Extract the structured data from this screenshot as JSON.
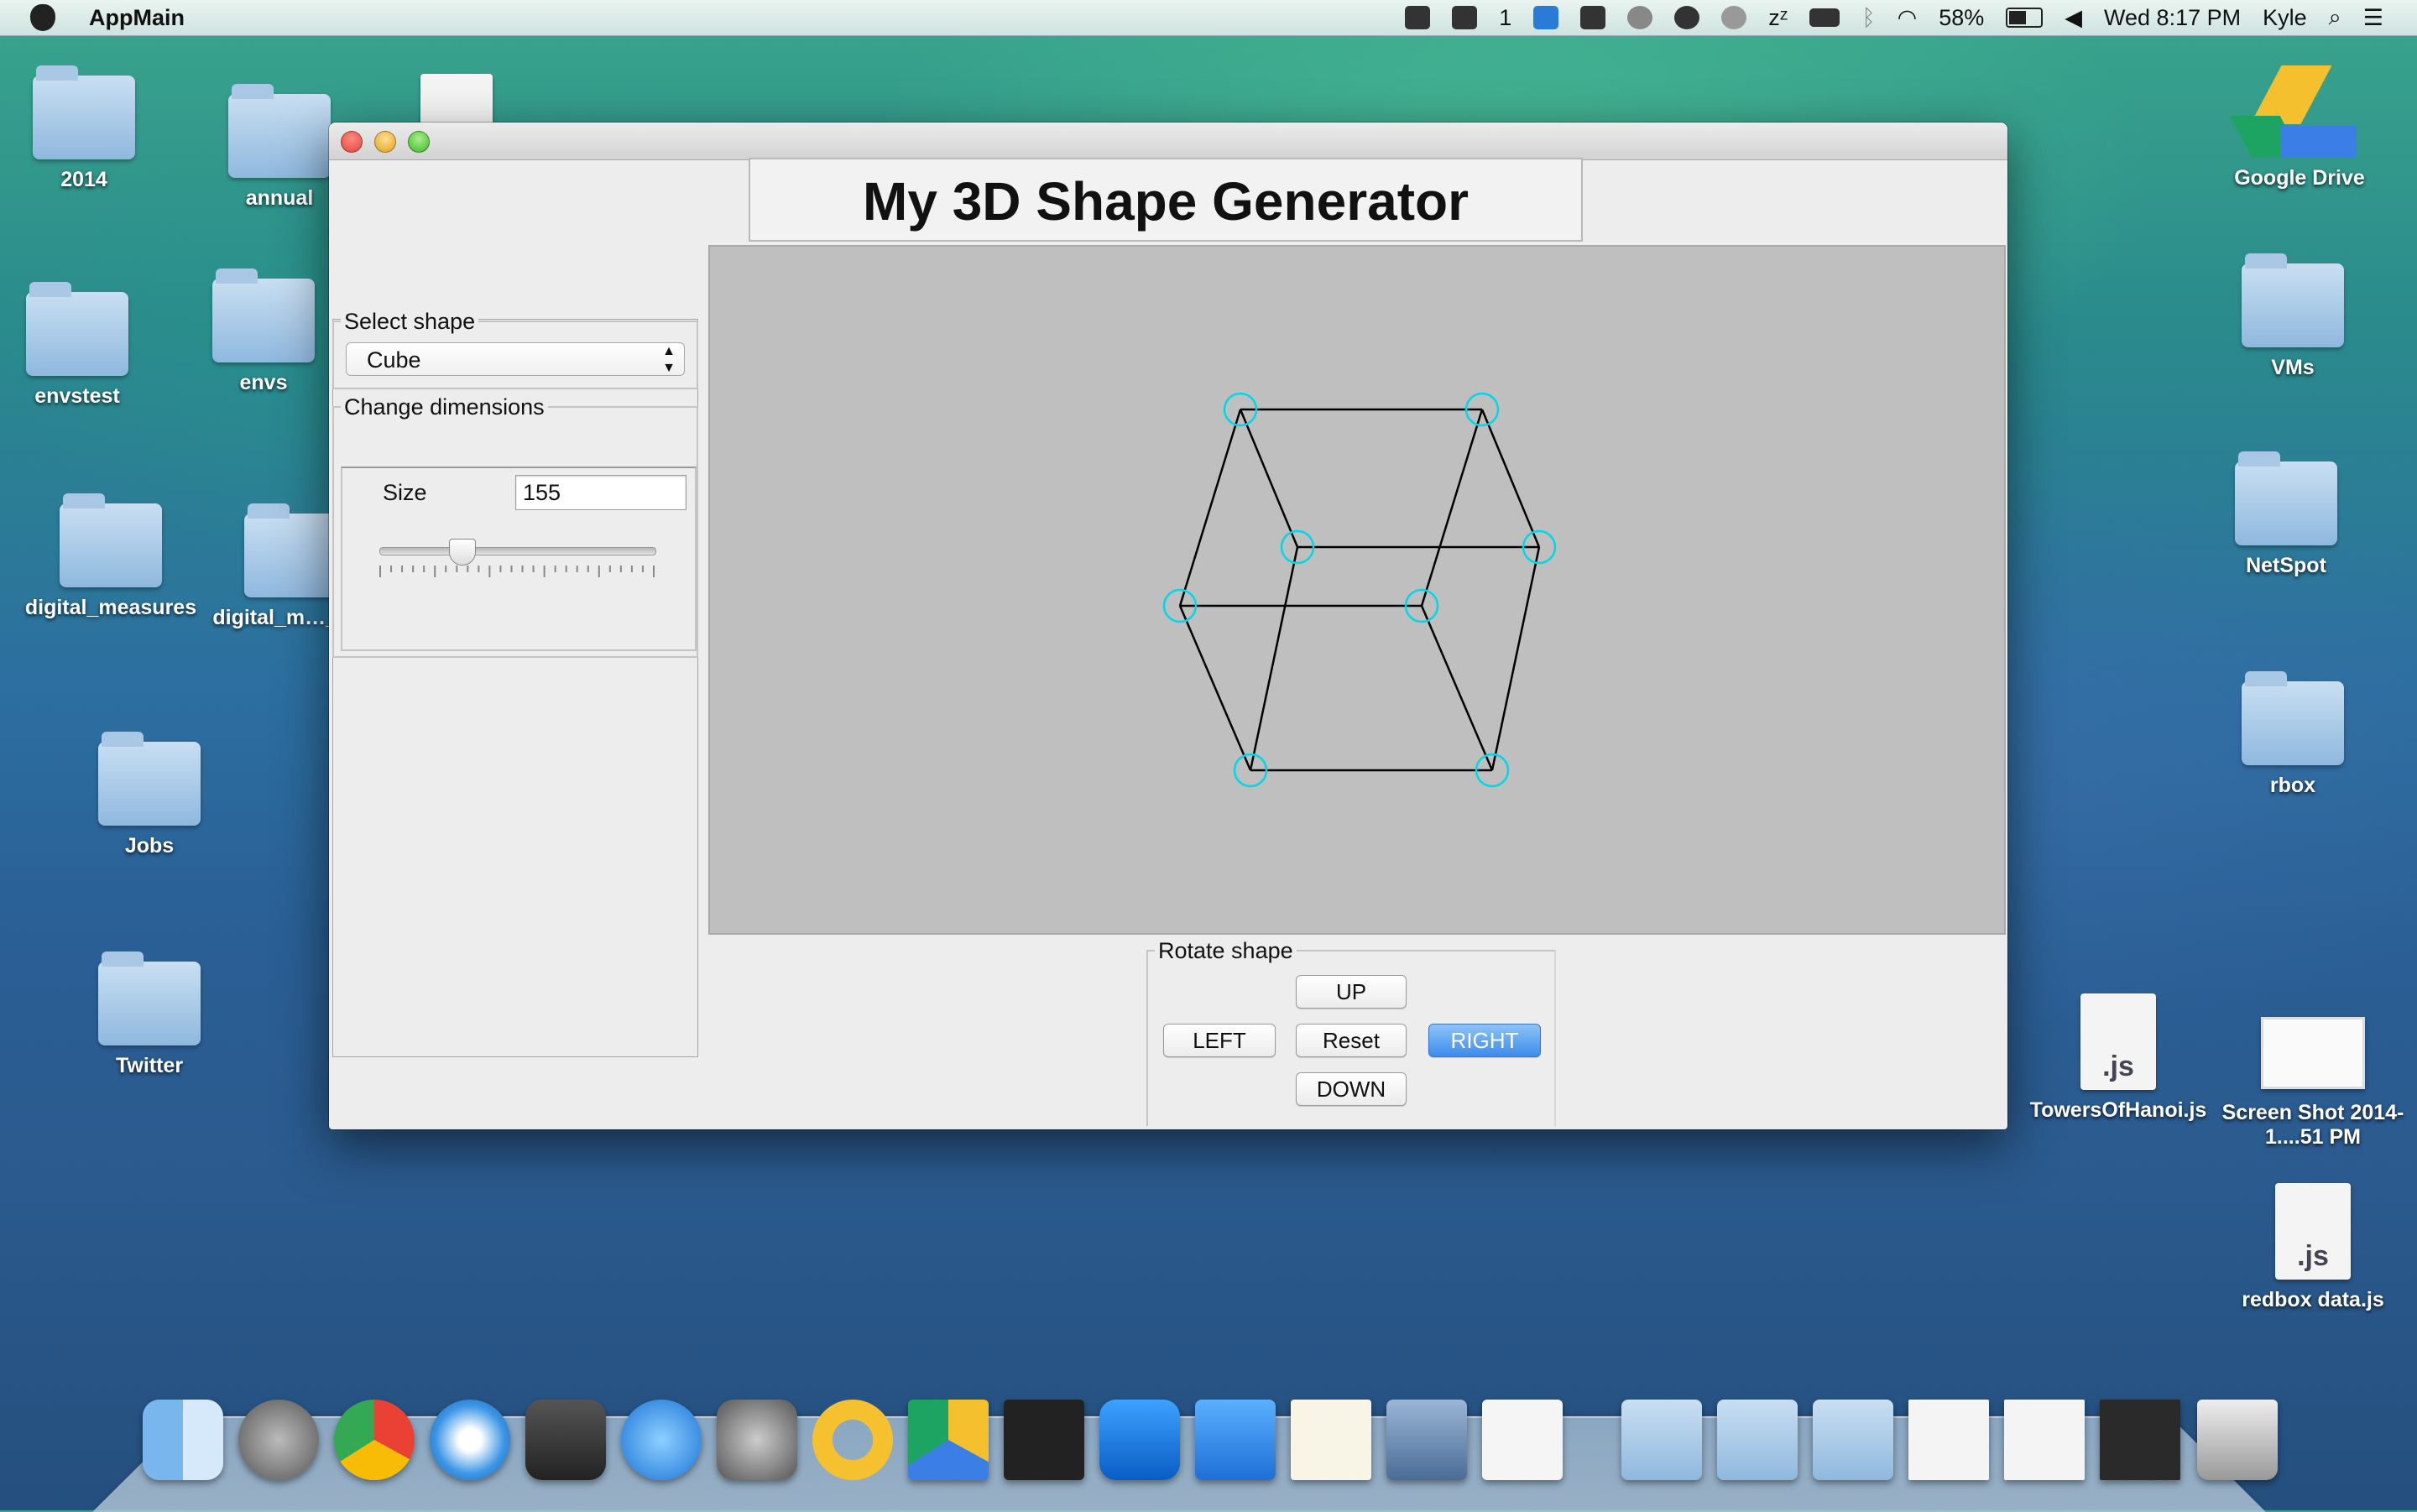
{
  "menubar": {
    "app_name": "AppMain",
    "space_number": "1",
    "battery_percent": "58%",
    "clock": "Wed 8:17 PM",
    "user": "Kyle",
    "icons": [
      "airplay-icon",
      "adobe-icon",
      "teamviewer-icon",
      "google-drive-icon",
      "disk-icon",
      "opera-icon",
      "globe-icon",
      "sleep-icon",
      "memory-icon",
      "bluetooth-icon",
      "wifi-icon",
      "battery-icon",
      "volume-icon",
      "spotlight-icon",
      "notification-center-icon"
    ]
  },
  "desktop": {
    "left_icons": [
      "2014",
      "annual",
      "envstest",
      "envs",
      "digital_measures",
      "digital_m…_TES",
      "Jobs",
      "Twitter"
    ],
    "right_icons": [
      "Google Drive",
      "VMs",
      "NetSpot",
      "rbox",
      "TowersOfHanoi.js",
      "Screen Shot 2014-1....51 PM",
      "redbox data.js"
    ]
  },
  "window": {
    "title": "My 3D Shape Generator",
    "select_shape": {
      "label": "Select shape",
      "value": "Cube"
    },
    "change_dimensions": {
      "label": "Change dimensions",
      "size_label": "Size",
      "size_value": "155",
      "slider_fraction": 0.3
    },
    "rotate": {
      "label": "Rotate shape",
      "up": "UP",
      "left": "LEFT",
      "reset": "Reset",
      "right": "RIGHT",
      "down": "DOWN"
    }
  },
  "dock": {
    "apps": [
      "finder-icon",
      "launchpad-icon",
      "chrome-icon",
      "safari-icon",
      "sublime-text-icon",
      "app-store-icon",
      "system-preferences-icon",
      "opera-icon",
      "google-drive-icon",
      "terminal-icon",
      "teamviewer-icon",
      "word-icon",
      "textedit-icon",
      "jira-icon",
      "java-icon",
      "applications-folder-icon",
      "documents-folder-icon",
      "downloads-folder-icon",
      "screenshot-thumb-icon",
      "screenshot-thumb-icon",
      "terminal-thumb-icon",
      "trash-icon"
    ]
  },
  "colors": {
    "canvas_bg": "#bfbfbf",
    "vertex_marker": "#00d8e8",
    "edge": "#000000",
    "default_button": "#3c8ceb"
  }
}
